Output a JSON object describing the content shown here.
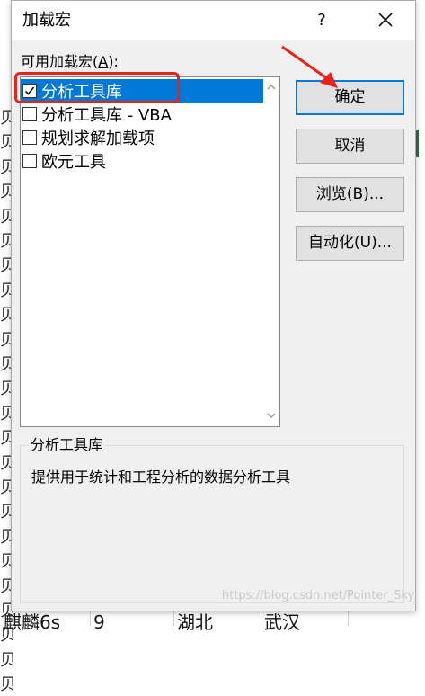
{
  "dialog": {
    "title": "加载宏",
    "help_label": "?",
    "list_label_prefix": "可用加载宏(",
    "list_label_key": "A",
    "list_label_suffix": "):",
    "addins": [
      {
        "label": "分析工具库",
        "checked": true,
        "selected": true
      },
      {
        "label": "分析工具库 - VBA",
        "checked": false,
        "selected": false
      },
      {
        "label": "规划求解加载项",
        "checked": false,
        "selected": false
      },
      {
        "label": "欧元工具",
        "checked": false,
        "selected": false
      }
    ],
    "buttons": {
      "ok": "确定",
      "cancel": "取消",
      "browse": "浏览(B)...",
      "automation": "自动化(U)..."
    },
    "description": {
      "title": "分析工具库",
      "text": "提供用于统计和工程分析的数据分析工具"
    }
  },
  "sheet": {
    "row_glyph": "贝",
    "bottom_row": {
      "col1": "麒麟6s",
      "col2": "9",
      "col3": "湖北",
      "col4": "武汉"
    }
  },
  "watermark": "https://blog.csdn.net/Pointer_Sky",
  "colors": {
    "selection": "#0078d7",
    "annotation": "#e8231b",
    "excel_green": "#217346"
  }
}
